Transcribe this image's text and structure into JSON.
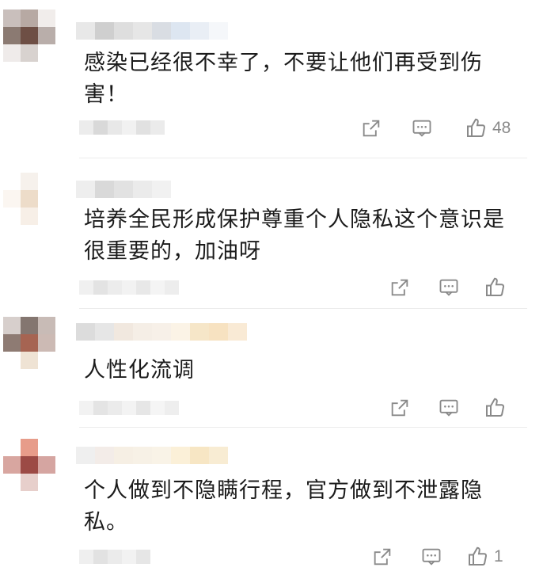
{
  "comments": [
    {
      "text": "感染已经很不幸了，不要让他们再受到伤害！",
      "likes": "48",
      "avatar_colors": [
        "#c9bfbc",
        "#b7a9a3",
        "#f1edeb",
        "#8b7a72",
        "#6e4f45",
        "#b9aeaa",
        "#efebea",
        "#d8d2cf",
        "#ffffff"
      ],
      "username_colors": [
        "#e8e8e8",
        "#cfcfcf",
        "#dedede",
        "#e6e6e6",
        "#d9dde3",
        "#dde6f1",
        "#e9eef5",
        "#f5f7fa"
      ],
      "meta_colors": [
        "#ececec",
        "#d9d9d9",
        "#e8e8e8",
        "#f1f1f1",
        "#e1e1e1",
        "#ebebeb"
      ]
    },
    {
      "text": "培养全民形成保护尊重个人隐私这个意识是很重要的，加油呀",
      "likes": "",
      "avatar_colors": [
        "#ffffff",
        "#f6f1ec",
        "#ffffff",
        "#fbf6f1",
        "#eddcc9",
        "#ffffff",
        "#ffffff",
        "#f7efe7",
        "#ffffff"
      ],
      "username_colors": [
        "#eeeeee",
        "#d9d9d9",
        "#e2e2e2",
        "#ebebeb",
        "#f1f1f1"
      ],
      "meta_colors": [
        "#f0f0f0",
        "#e3e3e3",
        "#ececec",
        "#f2f2f2",
        "#e8e8e8",
        "#f4f4f4",
        "#ededed"
      ]
    },
    {
      "text": "人性化流调",
      "likes": "",
      "avatar_colors": [
        "#d7cfcc",
        "#847670",
        "#c8bbb6",
        "#8e7b73",
        "#a66452",
        "#ccbab4",
        "#ffffff",
        "#efe3d4",
        "#ffffff"
      ],
      "username_colors": [
        "#dcdcdc",
        "#e6e6e6",
        "#f1e8df",
        "#f5eee6",
        "#f7f0e8",
        "#fbf3e6",
        "#f6e6c8",
        "#f7e2c1",
        "#f9ead5"
      ],
      "meta_colors": [
        "#f2f2f2",
        "#e4e4e4",
        "#ebebeb",
        "#f3f3f3",
        "#e6e6e6",
        "#f5f5f5",
        "#eeeeee"
      ]
    },
    {
      "text": "个人做到不隐瞒行程，官方做到不泄露隐私。",
      "likes": "1",
      "avatar_colors": [
        "#ffffff",
        "#e79c8a",
        "#ffffff",
        "#d8a6a0",
        "#9c4a45",
        "#d5a5a1",
        "#ffffff",
        "#e7cfcb",
        "#ffffff"
      ],
      "username_colors": [
        "#efefef",
        "#f3ece8",
        "#f6efe4",
        "#f7f1e6",
        "#f9f3e7",
        "#fbf0d8",
        "#f7e6c4",
        "#f8ecd3"
      ],
      "meta_colors": [
        "#efefef",
        "#e2e2e2",
        "#ebebeb",
        "#f2f2f2",
        "#e6e6e6"
      ]
    }
  ]
}
